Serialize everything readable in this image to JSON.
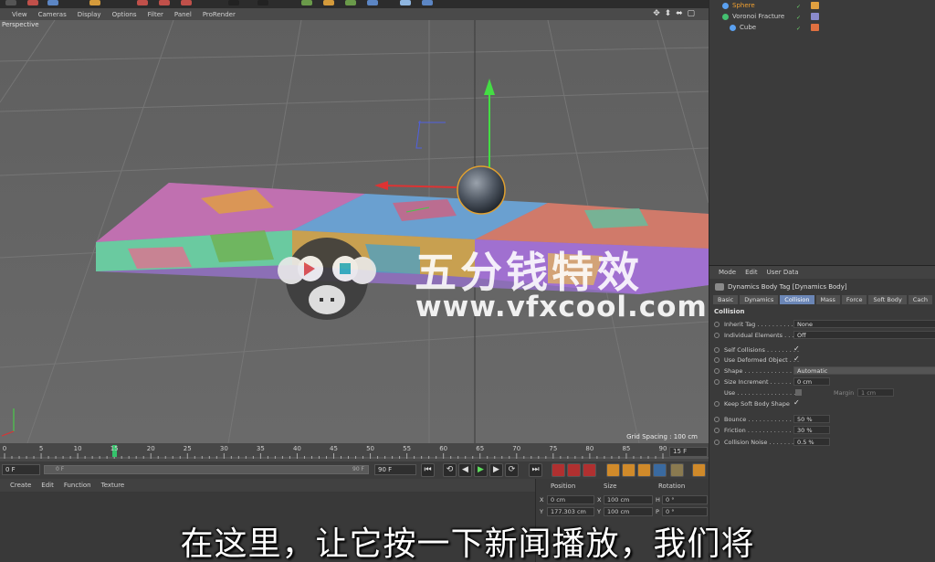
{
  "viewport": {
    "menu": [
      "View",
      "Cameras",
      "Display",
      "Options",
      "Filter",
      "Panel",
      "ProRender"
    ],
    "label": "Perspective",
    "grid_info": "Grid Spacing : 100 cm",
    "nav_icons": "✥ ⬍ ⬌ ▢"
  },
  "watermark": {
    "title": "五分钱特效",
    "url": "www.vfxcool.com"
  },
  "timeline": {
    "ticks": [
      "0",
      "5",
      "10",
      "15",
      "20",
      "25",
      "30",
      "35",
      "40",
      "45",
      "50",
      "55",
      "60",
      "65",
      "70",
      "75",
      "80",
      "85",
      "90"
    ],
    "fps": "15 F",
    "current_frame": 15,
    "max_frame": 90
  },
  "transport": {
    "start_field": "0 F",
    "range_start": "0 F",
    "range_end": "90 F",
    "end_field": "90 F",
    "buttons": [
      "⏮",
      "⟲",
      "◀",
      "▶",
      "▶",
      "⟳",
      "⏭"
    ]
  },
  "material_panel": {
    "menu": [
      "Create",
      "Edit",
      "Function",
      "Texture"
    ]
  },
  "coordinates": {
    "headers": {
      "position": "Position",
      "size": "Size",
      "rotation": "Rotation"
    },
    "rows": [
      {
        "axis": "X",
        "position": "0 cm",
        "size_axis": "X",
        "size": "100 cm",
        "rot_axis": "H",
        "rotation": "0 °"
      },
      {
        "axis": "Y",
        "position": "177.303 cm",
        "size_axis": "Y",
        "size": "100 cm",
        "rot_axis": "P",
        "rotation": "0 °"
      }
    ]
  },
  "objects": [
    {
      "name": "Sphere",
      "color": "#f0a030",
      "icon_color": "#5aa0f0"
    },
    {
      "name": "Voronoi Fracture",
      "color": "#d0d0d0",
      "icon_color": "#44c070"
    },
    {
      "name": "Cube",
      "color": "#d0d0d0",
      "icon_color": "#5aa0f0"
    }
  ],
  "attributes": {
    "menu": [
      "Mode",
      "Edit",
      "User Data"
    ],
    "title": "Dynamics Body Tag [Dynamics Body]",
    "tabs": [
      "Basic",
      "Dynamics",
      "Collision",
      "Mass",
      "Force",
      "Soft Body",
      "Cach"
    ],
    "active_tab": "Collision",
    "section": "Collision",
    "fields": {
      "inherit_tag_label": "Inherit Tag . . . . . . . . . . .",
      "inherit_tag": "None",
      "individual_label": "Individual Elements . . . .",
      "individual": "Off",
      "self_collisions_label": "Self Collisions . . . . . . . . .",
      "use_deformed_label": "Use Deformed Object . . .",
      "shape_label": "Shape . . . . . . . . . . . . . . . .",
      "shape": "Automatic",
      "size_increment_label": "Size Increment . . . . . . . .",
      "size_increment": "0 cm",
      "use_label": "Use . . . . . . . . . . . . . . . . .",
      "margin_label": "Margin",
      "margin": "1 cm",
      "keep_soft_label": "Keep Soft Body Shape",
      "bounce_label": "Bounce . . . . . . . . . . . . . .",
      "bounce": "50 %",
      "friction_label": "Friction . . . . . . . . . . . . . .",
      "friction": "30 %",
      "collision_noise_label": "Collision Noise . . . . . . . .",
      "collision_noise": "0.5 %",
      "check_glyph": "✓"
    }
  },
  "subtitle": "在这里，让它按一下新闻播放，我们将"
}
